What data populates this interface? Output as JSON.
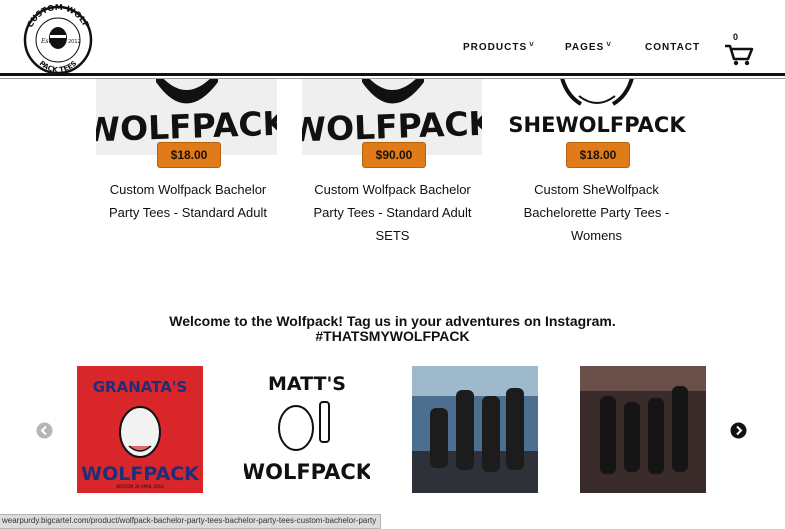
{
  "nav": {
    "products_label": "PRODUCTS",
    "pages_label": "PAGES",
    "contact_label": "CONTACT",
    "cart_count": "0"
  },
  "logo": {
    "top_text": "CUSTOM WOLF",
    "bottom_text": "PACK TEES",
    "est_label": "Est.",
    "year": "2012"
  },
  "products": [
    {
      "image_text": "WOLFPACK",
      "price": "$18.00",
      "title_lines": [
        "Custom Wolfpack Bachelor",
        "Party Tees - Standard Adult"
      ]
    },
    {
      "image_text": "WOLFPACK",
      "price": "$90.00",
      "title_lines": [
        "Custom Wolfpack Bachelor",
        "Party Tees - Standard Adult",
        "SETS"
      ]
    },
    {
      "image_text": "SHEWOLFPACK",
      "price": "$18.00",
      "title_lines": [
        "Custom SheWolfpack",
        "Bachelorette Party Tees -",
        "Womens"
      ]
    }
  ],
  "instagram": {
    "heading_line1": "Welcome to the Wolfpack! Tag us in your adventures on Instagram.",
    "heading_line2": "#THATSMYWOLFPACK",
    "tiles": [
      {
        "top_text": "GRANATA'S",
        "bottom_text": "WOLFPACK",
        "small_text": "BOSTON 30 APRIL 2016"
      },
      {
        "top_text": "MATT'S",
        "bottom_text": "WOLFPACK"
      },
      {},
      {}
    ]
  },
  "status_bar": {
    "url": "wearpurdy.bigcartel.com/product/wolfpack-bachelor-party-tees-bachelor-party-tees-custom-bachelor-party"
  },
  "colors": {
    "price_badge": "#e07b1a",
    "insta_red": "#d8262b",
    "insta_blue": "#1e2f7a"
  }
}
